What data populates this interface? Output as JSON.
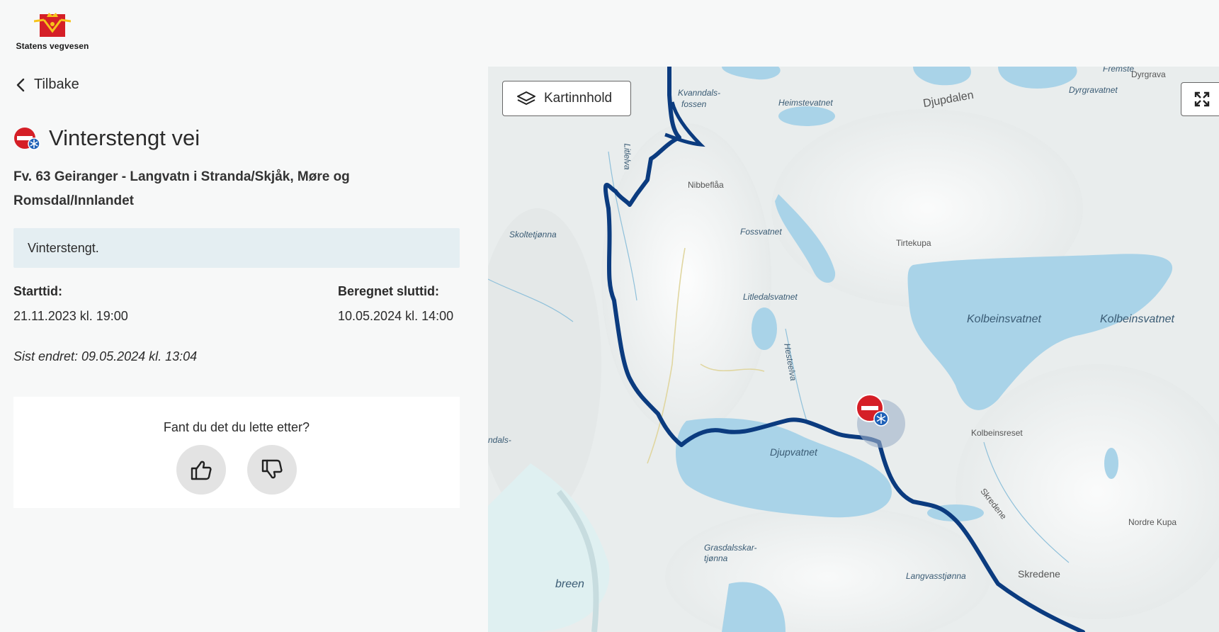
{
  "brand": {
    "name": "Statens vegvesen"
  },
  "nav": {
    "back_label": "Tilbake"
  },
  "event": {
    "title": "Vinterstengt vei",
    "icon": "winter-closed-road-icon",
    "route": "Fv. 63 Geiranger - Langvatn i Stranda/Skjåk, Møre og Romsdal/Innlandet",
    "description": "Vinterstengt.",
    "start_label": "Starttid:",
    "start_value": "21.11.2023 kl. 19:00",
    "end_label": "Beregnet sluttid:",
    "end_value": "10.05.2024 kl. 14:00",
    "last_changed": "Sist endret: 09.05.2024 kl. 13:04"
  },
  "feedback": {
    "question": "Fant du det du lette etter?",
    "yes_icon": "thumbs-up-icon",
    "no_icon": "thumbs-down-icon"
  },
  "map": {
    "layers_button_label": "Kartinnhold",
    "colors": {
      "road": "#0b3b7f",
      "water": "#a9d3e8",
      "closure_red": "#d51f27"
    },
    "labels": [
      "Kvanndals-",
      "fossen",
      "Heimstevatnet",
      "Djupdalen",
      "Dyrgravatnet",
      "Dyrgrava",
      "Fremste",
      "Litlelva",
      "Nibbeflåa",
      "Skoltetjønna",
      "Fossvatnet",
      "Tirtekupa",
      "Kolbeinsvatnet",
      "Kolbeinsvatnet",
      "Litledalsvatnet",
      "Hesteelva",
      "Kolbeinsreset",
      "Djupvatnet",
      "ndals-",
      "Skredene",
      "Nordre Kupa",
      "Grasdalsskar-",
      "tjønna",
      "Langvasstjønna",
      "Skredene",
      "breen"
    ]
  }
}
